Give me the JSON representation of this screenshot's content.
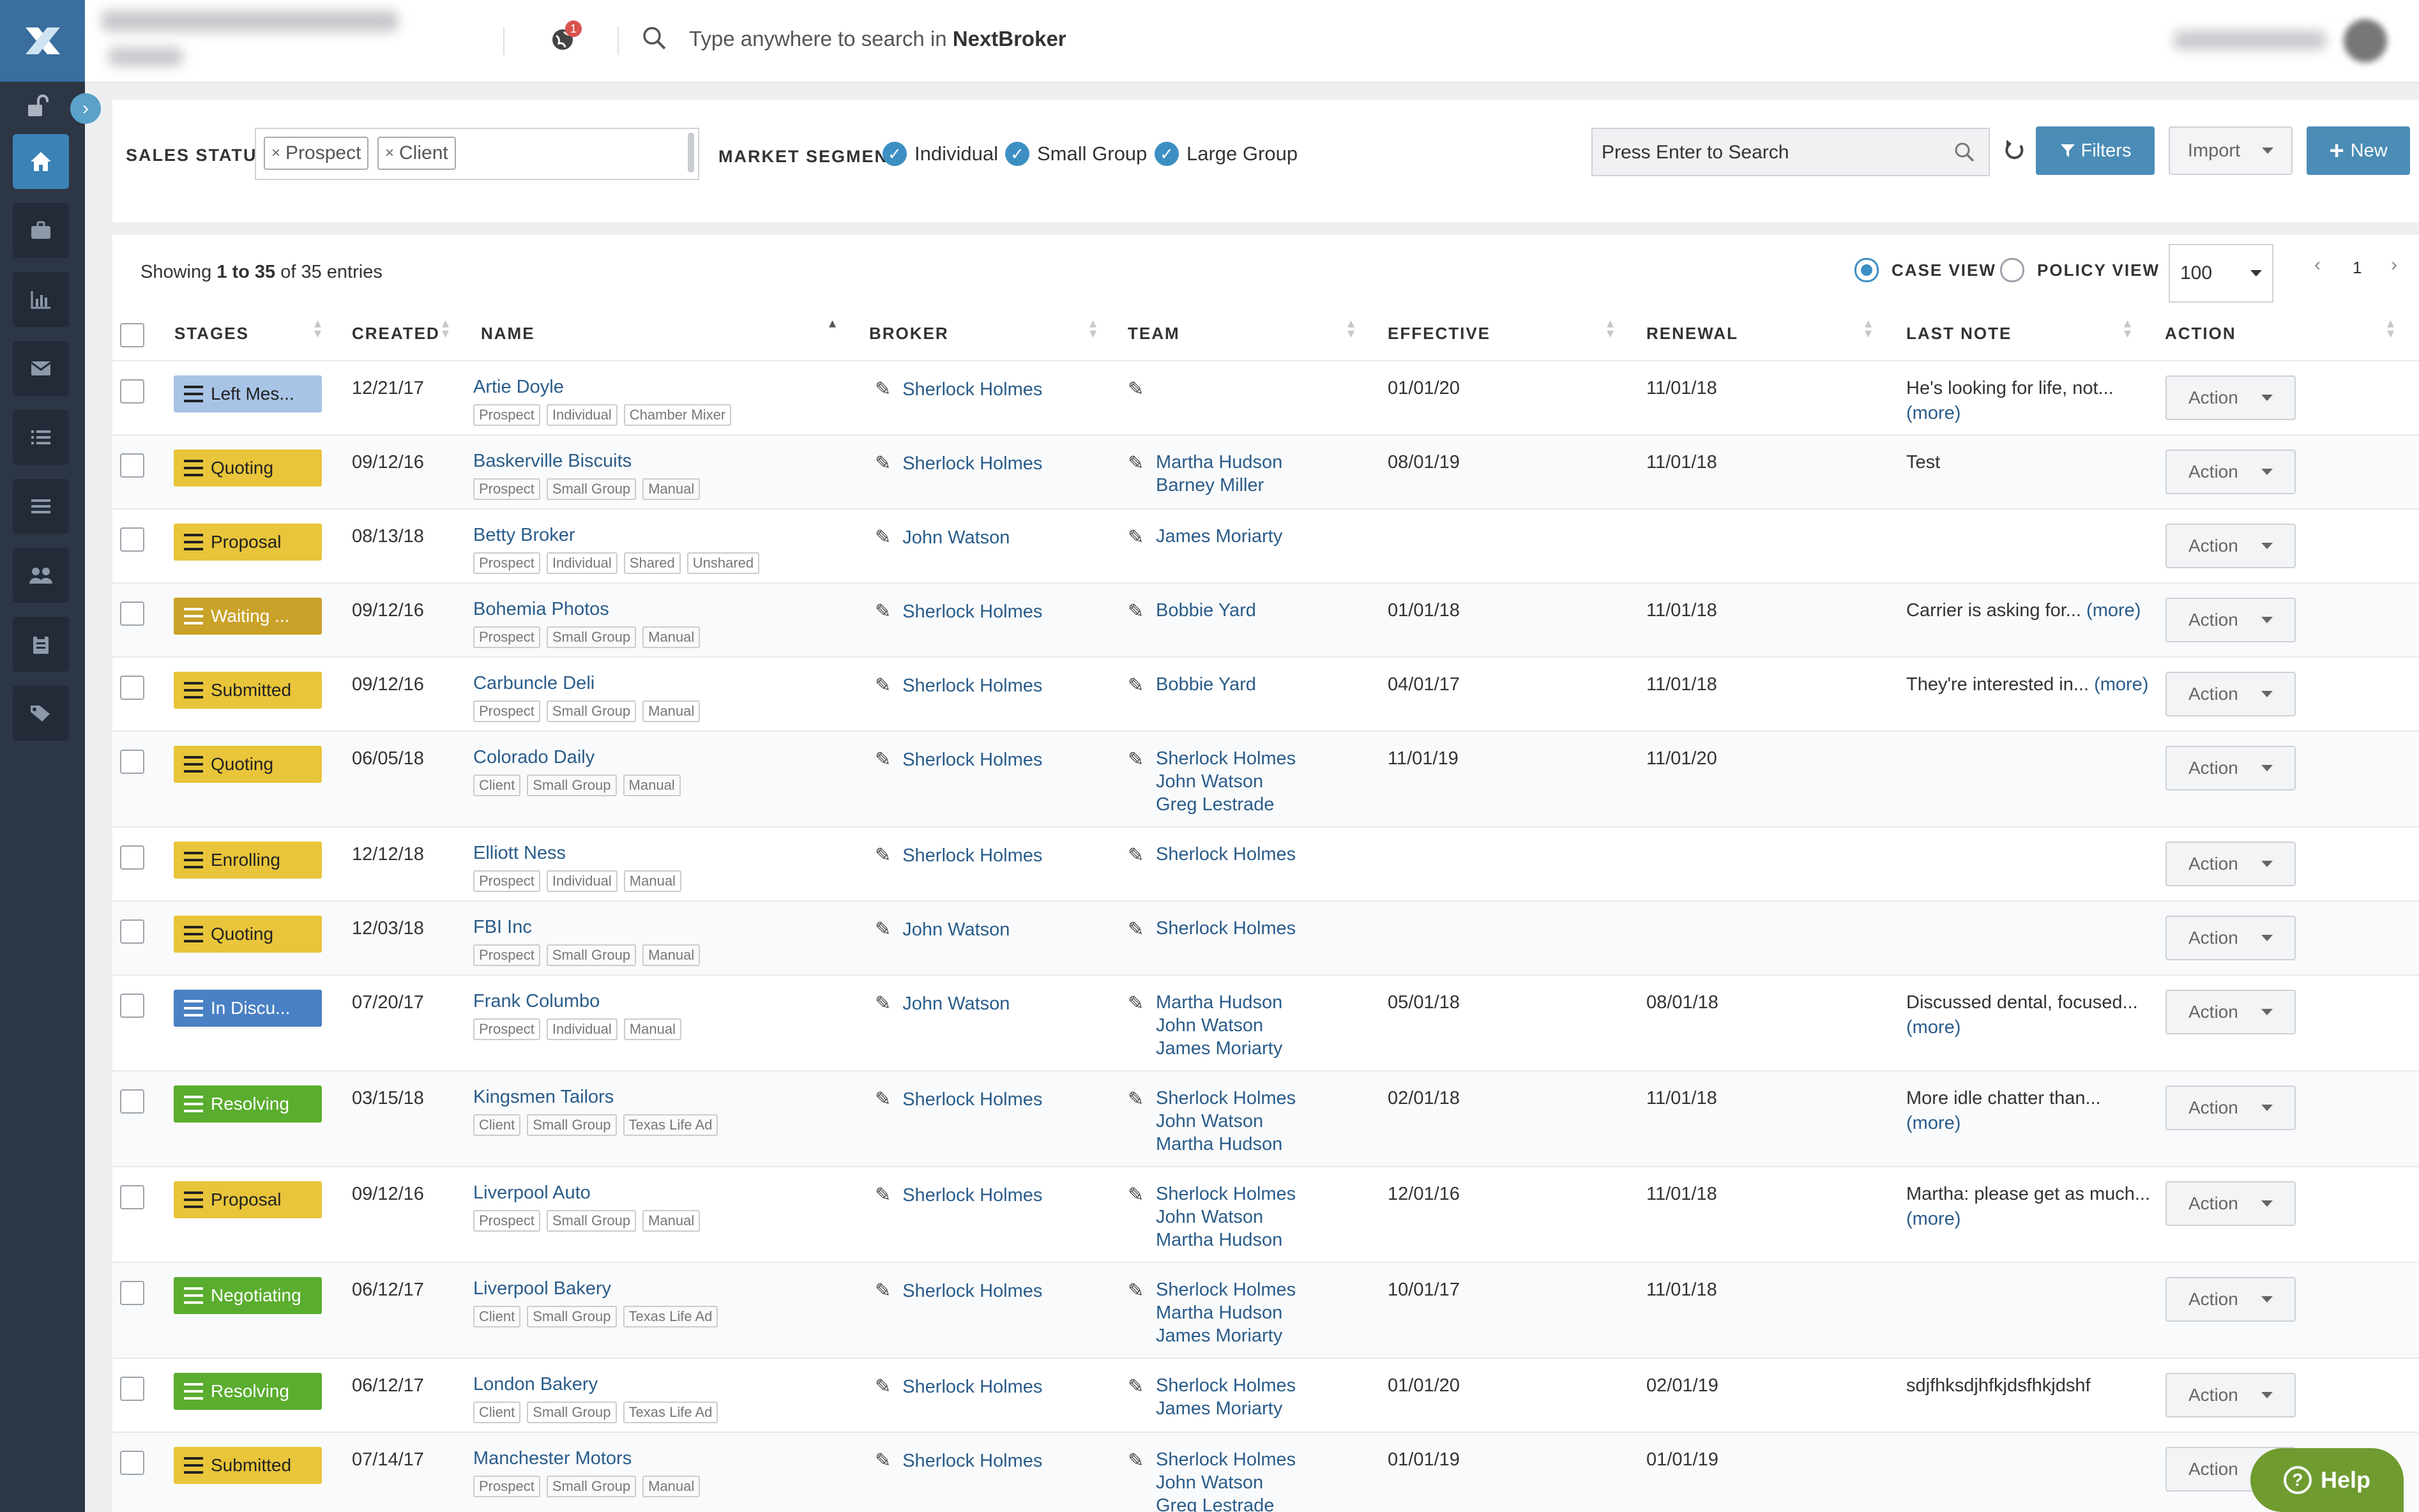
{
  "topbar": {
    "search_placeholder": "Type anywhere to search in ",
    "search_brand": "NextBroker",
    "notification_count": "1"
  },
  "filters": {
    "sales_status_label": "SALES STATUS",
    "chips": [
      "Prospect",
      "Client"
    ],
    "market_segment_label": "MARKET SEGMENT",
    "segments": [
      "Individual",
      "Small Group",
      "Large Group"
    ],
    "search_placeholder": "Press Enter to Search",
    "filters_label": "Filters",
    "import_label": "Import",
    "new_label": "New"
  },
  "table": {
    "showing_prefix": "Showing ",
    "showing_range": "1 to 35",
    "showing_suffix": " of 35 entries",
    "view_case": "CASE VIEW",
    "view_policy": "POLICY VIEW",
    "page_size": "100",
    "page": "1",
    "columns": [
      "STAGES",
      "CREATED",
      "NAME",
      "BROKER",
      "TEAM",
      "EFFECTIVE",
      "RENEWAL",
      "LAST NOTE",
      "ACTION"
    ],
    "action_label": "Action",
    "rows": [
      {
        "stage": "Left Mes...",
        "stage_color": "#a7c4e6",
        "created": "12/21/17",
        "name": "Artie Doyle",
        "tags": [
          "Prospect",
          "Individual",
          "Chamber Mixer"
        ],
        "broker": "Sherlock Holmes",
        "team": [],
        "effective": "01/01/20",
        "renewal": "11/01/18",
        "note": "He's looking for life, not...",
        "more": "(more)"
      },
      {
        "stage": "Quoting",
        "stage_color": "#e8c53a",
        "created": "09/12/16",
        "name": "Baskerville Biscuits",
        "tags": [
          "Prospect",
          "Small Group",
          "Manual"
        ],
        "broker": "Sherlock Holmes",
        "team": [
          "Martha Hudson",
          "Barney Miller"
        ],
        "effective": "08/01/19",
        "renewal": "11/01/18",
        "note": "Test",
        "more": ""
      },
      {
        "stage": "Proposal",
        "stage_color": "#e8c53a",
        "created": "08/13/18",
        "name": "Betty Broker",
        "tags": [
          "Prospect",
          "Individual",
          "Shared",
          "Unshared"
        ],
        "broker": "John Watson",
        "team": [
          "James Moriarty"
        ],
        "effective": "",
        "renewal": "",
        "note": "",
        "more": ""
      },
      {
        "stage": "Waiting ...",
        "stage_color": "#c9a22a",
        "created": "09/12/16",
        "name": "Bohemia Photos",
        "tags": [
          "Prospect",
          "Small Group",
          "Manual"
        ],
        "broker": "Sherlock Holmes",
        "team": [
          "Bobbie Yard"
        ],
        "effective": "01/01/18",
        "renewal": "11/01/18",
        "note": "Carrier is asking for...",
        "more": "(more)"
      },
      {
        "stage": "Submitted",
        "stage_color": "#e8c53a",
        "created": "09/12/16",
        "name": "Carbuncle Deli",
        "tags": [
          "Prospect",
          "Small Group",
          "Manual"
        ],
        "broker": "Sherlock Holmes",
        "team": [
          "Bobbie Yard"
        ],
        "effective": "04/01/17",
        "renewal": "11/01/18",
        "note": "They're interested in...",
        "more": "(more)"
      },
      {
        "stage": "Quoting",
        "stage_color": "#e8c53a",
        "created": "06/05/18",
        "name": "Colorado Daily",
        "tags": [
          "Client",
          "Small Group",
          "Manual"
        ],
        "broker": "Sherlock Holmes",
        "team": [
          "Sherlock Holmes",
          "John Watson",
          "Greg Lestrade"
        ],
        "effective": "11/01/19",
        "renewal": "11/01/20",
        "note": "",
        "more": ""
      },
      {
        "stage": "Enrolling",
        "stage_color": "#e8c53a",
        "created": "12/12/18",
        "name": "Elliott Ness",
        "tags": [
          "Prospect",
          "Individual",
          "Manual"
        ],
        "broker": "Sherlock Holmes",
        "team": [
          "Sherlock Holmes"
        ],
        "effective": "",
        "renewal": "",
        "note": "",
        "more": ""
      },
      {
        "stage": "Quoting",
        "stage_color": "#e8c53a",
        "created": "12/03/18",
        "name": "FBI Inc",
        "tags": [
          "Prospect",
          "Small Group",
          "Manual"
        ],
        "broker": "John Watson",
        "team": [
          "Sherlock Holmes"
        ],
        "effective": "",
        "renewal": "",
        "note": "",
        "more": ""
      },
      {
        "stage": "In Discu...",
        "stage_color": "#4a80c4",
        "created": "07/20/17",
        "name": "Frank Columbo",
        "tags": [
          "Prospect",
          "Individual",
          "Manual"
        ],
        "broker": "John Watson",
        "team": [
          "Martha Hudson",
          "John Watson",
          "James Moriarty"
        ],
        "effective": "05/01/18",
        "renewal": "08/01/18",
        "note": "Discussed dental, focused...",
        "more": "(more)"
      },
      {
        "stage": "Resolving",
        "stage_color": "#5aad2e",
        "created": "03/15/18",
        "name": "Kingsmen Tailors",
        "tags": [
          "Client",
          "Small Group",
          "Texas Life Ad"
        ],
        "broker": "Sherlock Holmes",
        "team": [
          "Sherlock Holmes",
          "John Watson",
          "Martha Hudson"
        ],
        "effective": "02/01/18",
        "renewal": "11/01/18",
        "note": "More idle chatter than...",
        "more": "(more)"
      },
      {
        "stage": "Proposal",
        "stage_color": "#e8c53a",
        "created": "09/12/16",
        "name": "Liverpool Auto",
        "tags": [
          "Prospect",
          "Small Group",
          "Manual"
        ],
        "broker": "Sherlock Holmes",
        "team": [
          "Sherlock Holmes",
          "John Watson",
          "Martha Hudson"
        ],
        "effective": "12/01/16",
        "renewal": "11/01/18",
        "note": "Martha: please get as much...",
        "more": "(more)"
      },
      {
        "stage": "Negotiating",
        "stage_color": "#5aad2e",
        "created": "06/12/17",
        "name": "Liverpool Bakery",
        "tags": [
          "Client",
          "Small Group",
          "Texas Life Ad"
        ],
        "broker": "Sherlock Holmes",
        "team": [
          "Sherlock Holmes",
          "Martha Hudson",
          "James Moriarty"
        ],
        "effective": "10/01/17",
        "renewal": "11/01/18",
        "note": "",
        "more": ""
      },
      {
        "stage": "Resolving",
        "stage_color": "#5aad2e",
        "created": "06/12/17",
        "name": "London Bakery",
        "tags": [
          "Client",
          "Small Group",
          "Texas Life Ad"
        ],
        "broker": "Sherlock Holmes",
        "team": [
          "Sherlock Holmes",
          "James Moriarty"
        ],
        "effective": "01/01/20",
        "renewal": "02/01/19",
        "note": "sdjfhksdjhfkjdsfhkjdshf",
        "more": ""
      },
      {
        "stage": "Submitted",
        "stage_color": "#e8c53a",
        "created": "07/14/17",
        "name": "Manchester Motors",
        "tags": [
          "Prospect",
          "Small Group",
          "Manual"
        ],
        "broker": "Sherlock Holmes",
        "team": [
          "Sherlock Holmes",
          "John Watson",
          "Greg Lestrade"
        ],
        "effective": "01/01/19",
        "renewal": "01/01/19",
        "note": "",
        "more": ""
      }
    ]
  },
  "help_label": "Help"
}
